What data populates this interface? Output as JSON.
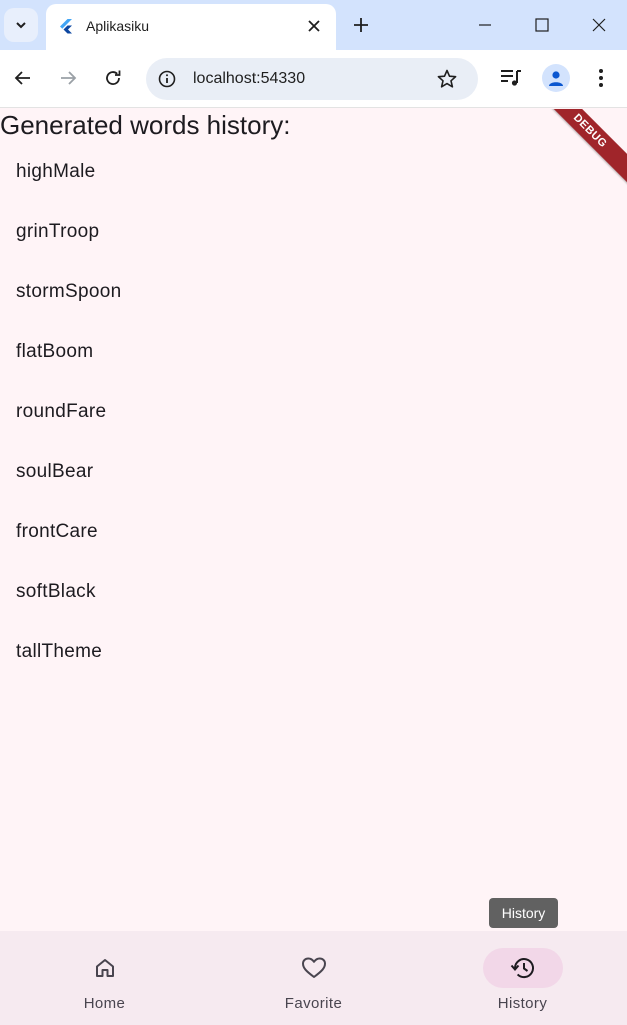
{
  "browser": {
    "tab_title": "Aplikasiku",
    "url": "localhost:54330"
  },
  "page": {
    "heading": "Generated words history:",
    "debug_banner": "DEBUG",
    "words": [
      "highMale",
      "grinTroop",
      "stormSpoon",
      "flatBoom",
      "roundFare",
      "soulBear",
      "frontCare",
      "softBlack",
      "tallTheme"
    ],
    "tooltip": "History"
  },
  "nav": {
    "items": [
      {
        "label": "Home",
        "icon": "home-icon",
        "active": false
      },
      {
        "label": "Favorite",
        "icon": "heart-icon",
        "active": false
      },
      {
        "label": "History",
        "icon": "history-icon",
        "active": true
      }
    ]
  },
  "colors": {
    "tabstrip": "#d3e3fd",
    "page_background": "#fff4f7",
    "nav_background": "#f6eaf0",
    "active_indicator": "#f2d7e8",
    "debug_banner": "#a0252a"
  }
}
